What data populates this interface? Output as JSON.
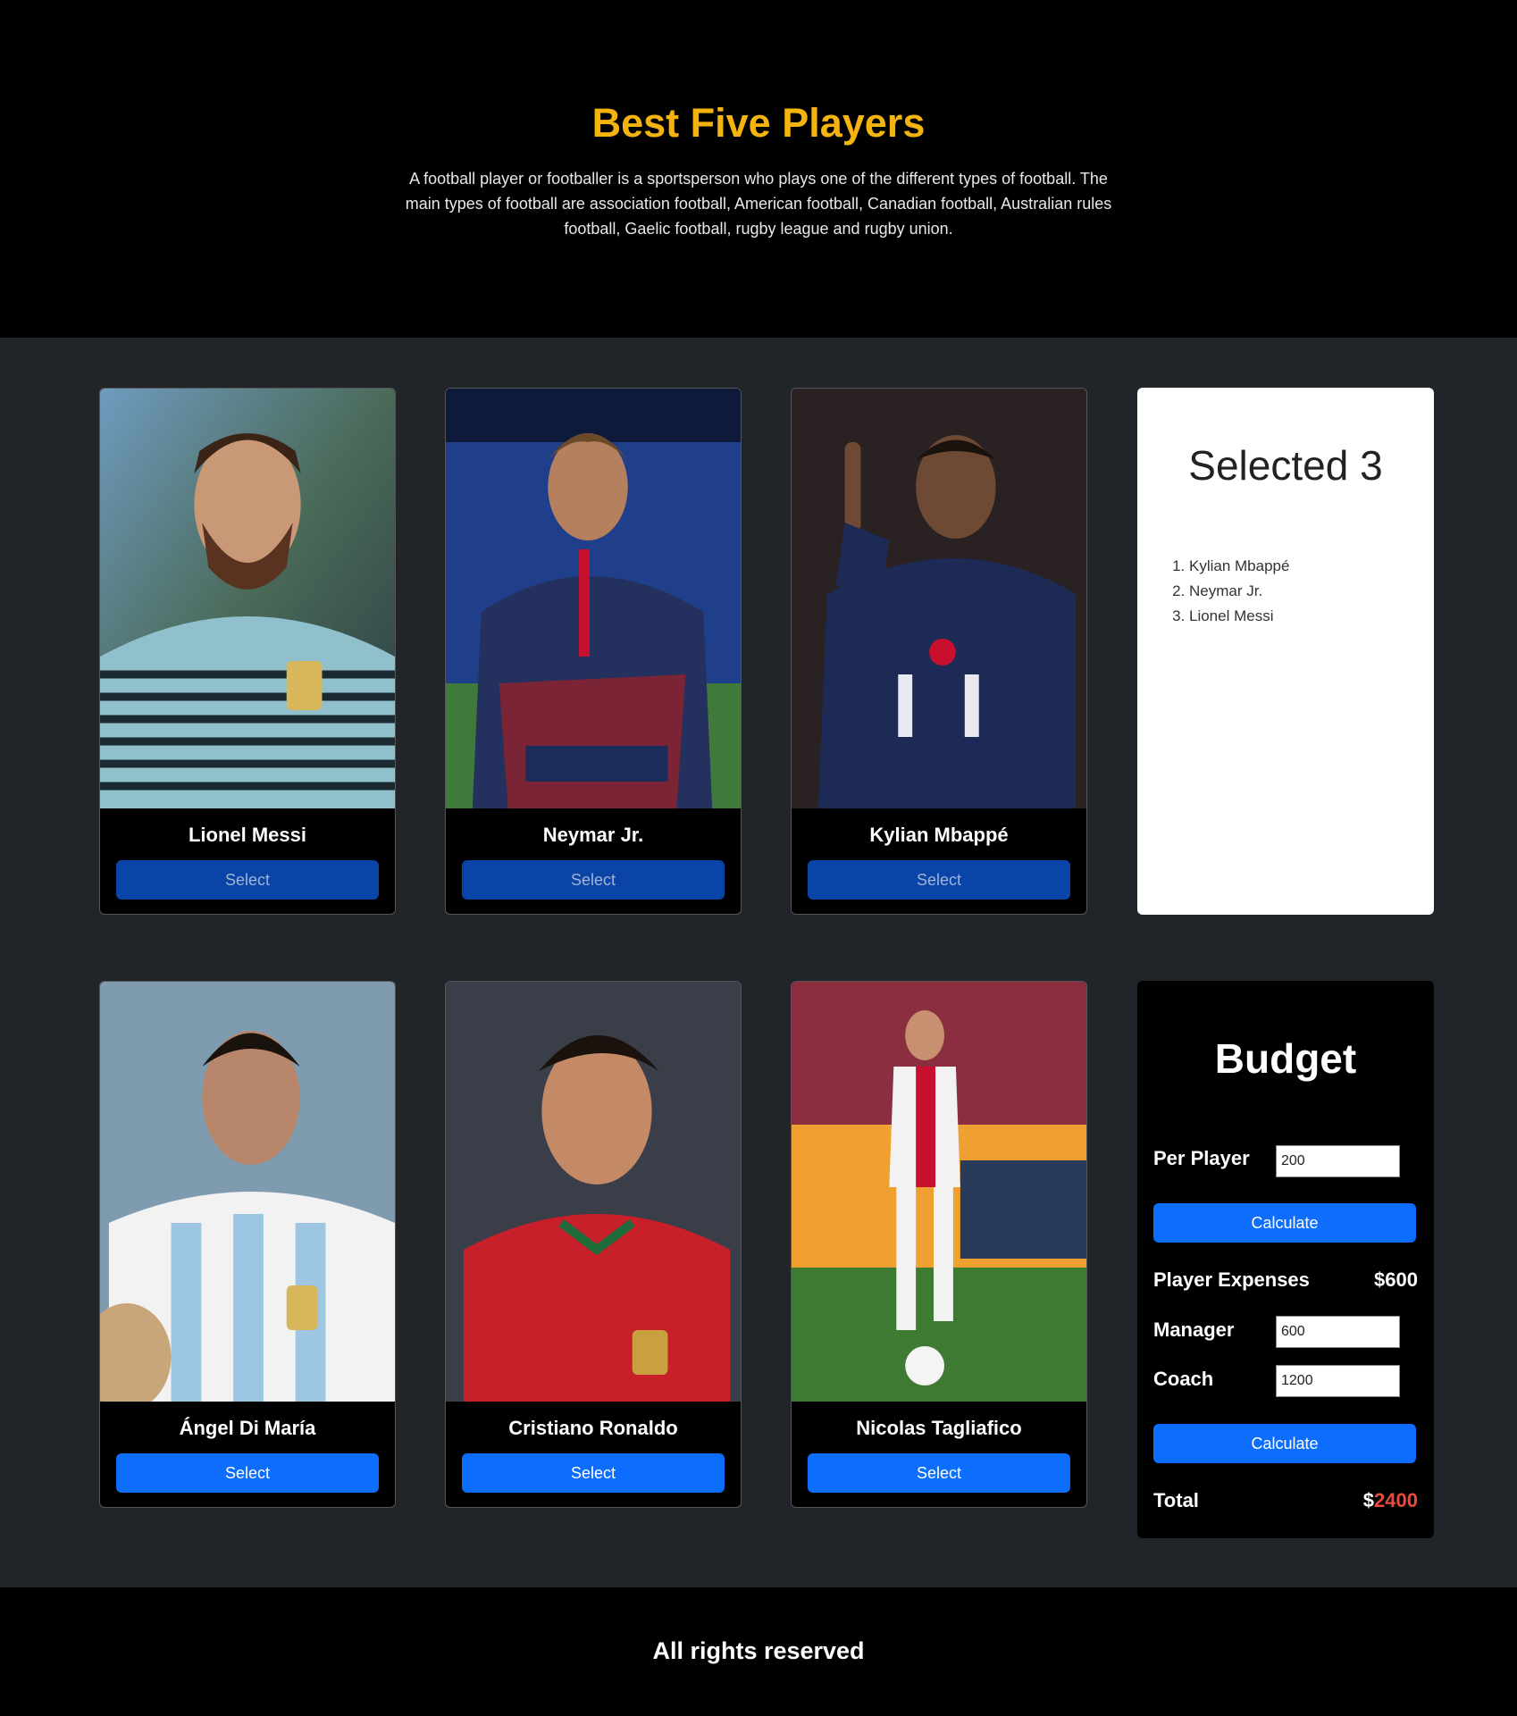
{
  "header": {
    "title": "Best Five Players",
    "description": "A football player or footballer is a sportsperson who plays one of the different types of football. The main types of football are association football, American football, Canadian football, Australian rules football, Gaelic football, rugby league and rugby union."
  },
  "players": [
    {
      "name": "Lionel Messi",
      "button": "Select",
      "image": "Lionel Messi portrait in Argentina training jersey"
    },
    {
      "name": "Neymar Jr.",
      "button": "Select",
      "image": "Neymar Jr. in PSG kit holding jersey"
    },
    {
      "name": "Kylian Mbappé",
      "button": "Select",
      "image": "Kylian Mbappé celebrating in PSG kit"
    },
    {
      "name": "Ángel Di María",
      "button": "Select",
      "image": "Ángel Di María in Argentina kit"
    },
    {
      "name": "Cristiano Ronaldo",
      "button": "Select",
      "image": "Cristiano Ronaldo in Portugal kit"
    },
    {
      "name": "Nicolas Tagliafico",
      "button": "Select",
      "image": "Nicolas Tagliafico running with ball in Ajax kit"
    }
  ],
  "selected": {
    "title": "Selected 3",
    "items": [
      "Kylian Mbappé",
      "Neymar Jr.",
      "Lionel Messi"
    ]
  },
  "budget": {
    "title": "Budget",
    "per_player_label": "Per Player",
    "per_player_value": "200",
    "calculate_label": "Calculate",
    "player_expenses_label": "Player Expenses",
    "player_expenses_value": "$600",
    "manager_label": "Manager",
    "manager_value": "600",
    "coach_label": "Coach",
    "coach_value": "1200",
    "total_label": "Total",
    "total_currency": "$",
    "total_value": "2400"
  },
  "footer": {
    "text": "All rights reserved"
  },
  "colors": {
    "accent": "#f5b30f",
    "button": "#0d6efd",
    "button_disabled": "#0a44a6",
    "total": "#e74c3c"
  }
}
